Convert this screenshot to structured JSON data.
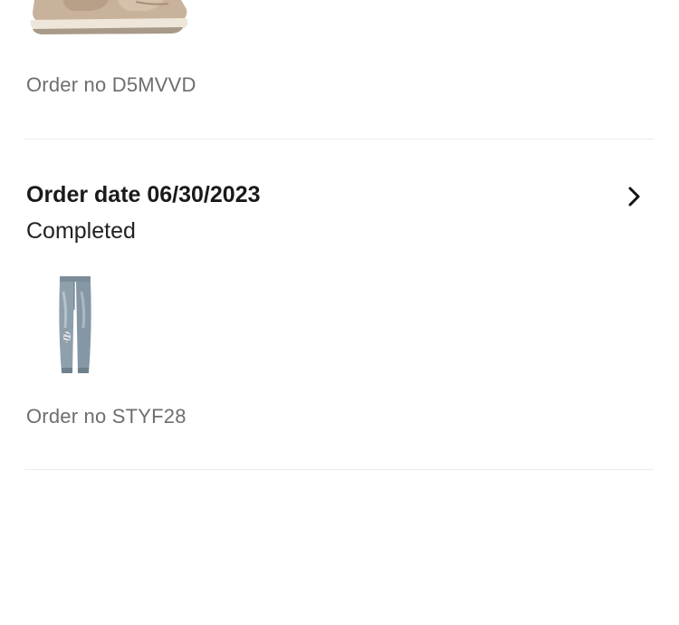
{
  "orders": [
    {
      "date_label": "",
      "status": "",
      "order_no": "Order no D5MVVD",
      "product_icon": "sneaker-image"
    },
    {
      "date_label": "Order date 06/30/2023",
      "status": "Completed",
      "order_no": "Order no STYF28",
      "product_icon": "jeans-image",
      "chevron_icon": "chevron-right-icon"
    }
  ],
  "colors": {
    "divider": "#ececec",
    "secondary_text": "#6e6e6e",
    "sneaker_suede": "#c9b29b",
    "sole": "#e8e0d4",
    "denim": "#8a9aa8"
  }
}
